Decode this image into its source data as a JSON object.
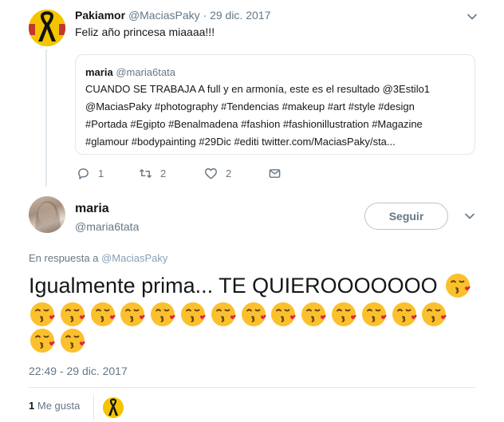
{
  "parent_tweet": {
    "name": "Pakiamor",
    "handle": "@MaciasPaky",
    "dot": "·",
    "date": "29 dic. 2017",
    "text": "Feliz año princesa miaaaa!!!",
    "quote": {
      "name": "maria",
      "handle": "@maria6tata",
      "lines": [
        "CUANDO SE TRABAJA A full y en armonía, este es el resultado @3Estilo1",
        "@MaciasPaky  #photography #Tendencias #makeup #art #style #design",
        "#Portada #Egipto #Benalmadena #fashion #fashionillustration #Magazine",
        "#glamour #bodypainting  #29Dic #editi twitter.com/MaciasPaky/sta..."
      ]
    },
    "actions": {
      "reply_count": "1",
      "retweet_count": "2",
      "like_count": "2"
    },
    "icons": [
      "reply-icon",
      "retweet-icon",
      "like-icon",
      "message-icon",
      "chevron-down-icon"
    ]
  },
  "main_tweet": {
    "name": "maria",
    "handle": "@maria6tata",
    "follow_label": "Seguir",
    "reply_prefix": "En respuesta a",
    "reply_handle": "@MaciasPaky",
    "text": "Igualmente prima... TE QUIEROOOOOOO",
    "emoji_name": "face-blowing-a-kiss",
    "emoji_count": 17,
    "timestamp": "22:49 - 29 dic. 2017",
    "likes_count": "1",
    "likes_label": "Me gusta"
  },
  "colors": {
    "secondary_text": "#657786",
    "border": "#e1e8ed",
    "emoji_yellow": "#fbc02d",
    "heart_red": "#e5243b",
    "avatar_yellow": "#f5c400"
  }
}
